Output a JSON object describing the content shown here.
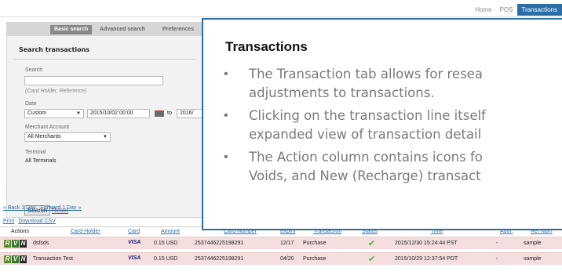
{
  "topnav": {
    "items": [
      "Home",
      "POS",
      "Transactions"
    ],
    "active": "Transactions"
  },
  "subtabs": [
    "Basic search",
    "Advanced search",
    "Preferences"
  ],
  "panel": {
    "title": "Search transactions",
    "search_label": "Search",
    "search_value": "",
    "search_hint": "(Card Holder, Reference)",
    "date_label": "Date",
    "date_mode": "Custom",
    "date_from": "2015/10/02 00:00",
    "to_label": "to",
    "date_to": "2016/",
    "merchant_label": "Merchant Account",
    "merchant_value": "All Merchants",
    "terminal_label": "Terminal",
    "terminal_value": "All Terminals",
    "search_button": "Search",
    "reset_link": "Reset"
  },
  "pager": {
    "back": "« Back 1 Day",
    "forward": "Forward 1 Day »"
  },
  "tools": {
    "print": "Print",
    "download": "Download CSV"
  },
  "table": {
    "headers": [
      "Actions",
      "Card Holder",
      "Card",
      "Amount",
      "Card Number",
      "Expiry",
      "Transaction",
      "Status",
      "Time",
      "Auth.",
      "Ref Num"
    ],
    "rows": [
      {
        "holder": "dsfsds",
        "card": "VISA",
        "amount": "0.15 USD",
        "number": "2537446225198291",
        "expiry": "12/17",
        "type": "Purchase",
        "time": "2015/12/30 15:24:44 PST",
        "auth": "-",
        "ref": "sample"
      },
      {
        "holder": "Transaction Test",
        "card": "VISA",
        "amount": "0.15 USD",
        "number": "2537446225198291",
        "expiry": "04/20",
        "type": "Purchase",
        "time": "2015/10/29 12:37:54 PDT",
        "auth": "-",
        "ref": "sample"
      }
    ]
  },
  "callout": {
    "title": "Transactions",
    "lines": [
      "The Transaction tab allows for resea",
      "adjustments to transactions.",
      "Clicking on the transaction line itself",
      "expanded view of transaction detail",
      "The Action column contains icons fo",
      "Voids, and New (Recharge) transact"
    ]
  },
  "colors": {
    "accent": "#2b6ea6",
    "row_bg": "#f4dede",
    "reset": "#cc3333",
    "status_ok": "#4caf50"
  },
  "icons": {
    "calendar": "calendar-icon",
    "status": "check-icon",
    "refund": "refund-icon",
    "void": "void-icon",
    "new": "new-icon"
  }
}
